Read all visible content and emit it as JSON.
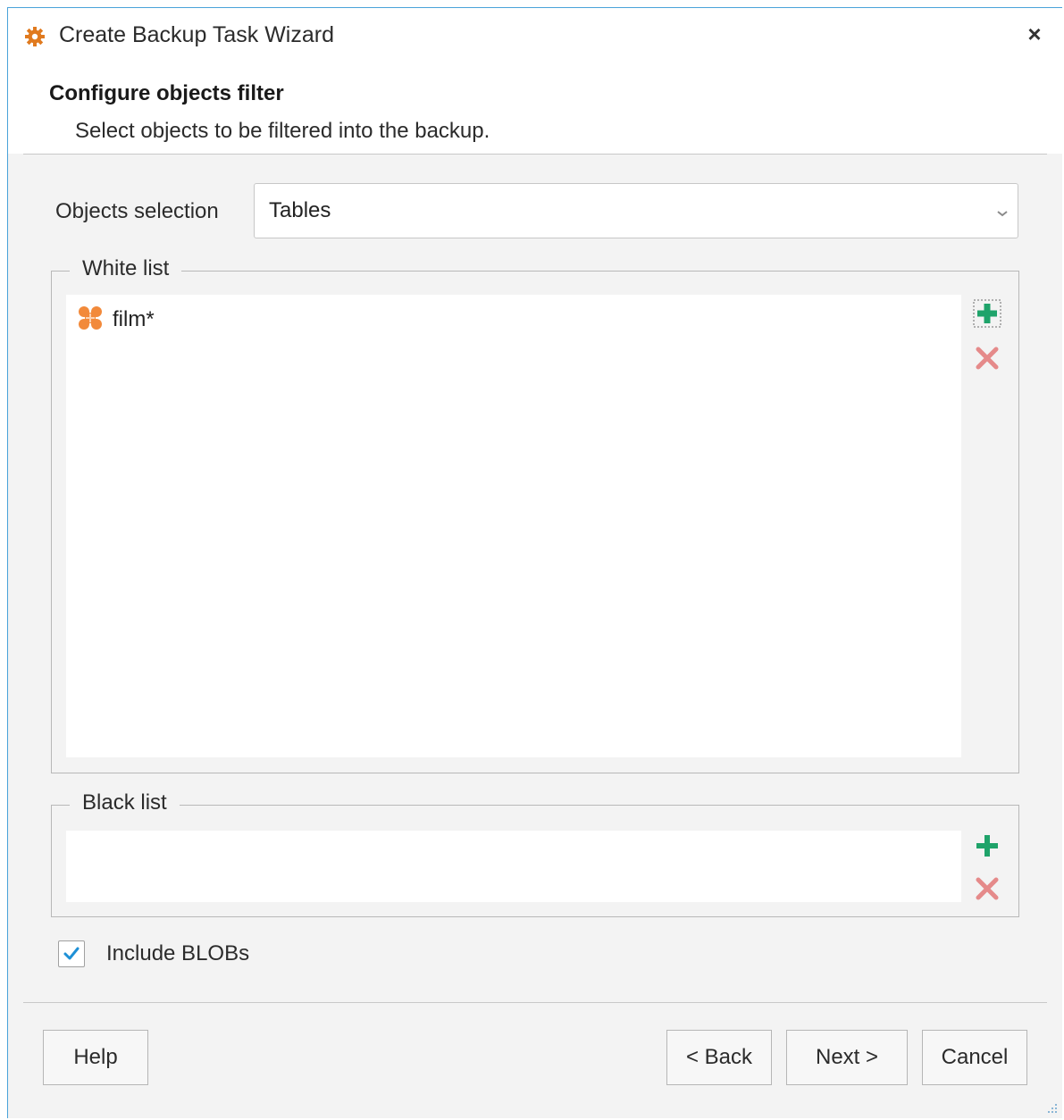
{
  "window": {
    "title": "Create Backup Task Wizard",
    "close_glyph": "×",
    "icon": "gear-icon",
    "accent_color": "#e07a1f"
  },
  "header": {
    "title": "Configure objects filter",
    "subtitle": "Select objects to be filtered into the backup."
  },
  "objects_selection": {
    "label": "Objects selection",
    "value": "Tables"
  },
  "white_list": {
    "legend": "White list",
    "items": [
      {
        "label": "film*",
        "icon": "table-mask-icon"
      }
    ],
    "add_icon": "plus-icon",
    "remove_icon": "remove-x-icon"
  },
  "black_list": {
    "legend": "Black list",
    "items": [],
    "add_icon": "plus-icon",
    "remove_icon": "remove-x-icon"
  },
  "include_blobs": {
    "label": "Include BLOBs",
    "checked": true
  },
  "buttons": {
    "help": "Help",
    "back": "< Back",
    "next": "Next >",
    "cancel": "Cancel"
  },
  "colors": {
    "add_green": "#1fa36a",
    "remove_red": "#e58a8a",
    "check_blue": "#1e90d6"
  }
}
